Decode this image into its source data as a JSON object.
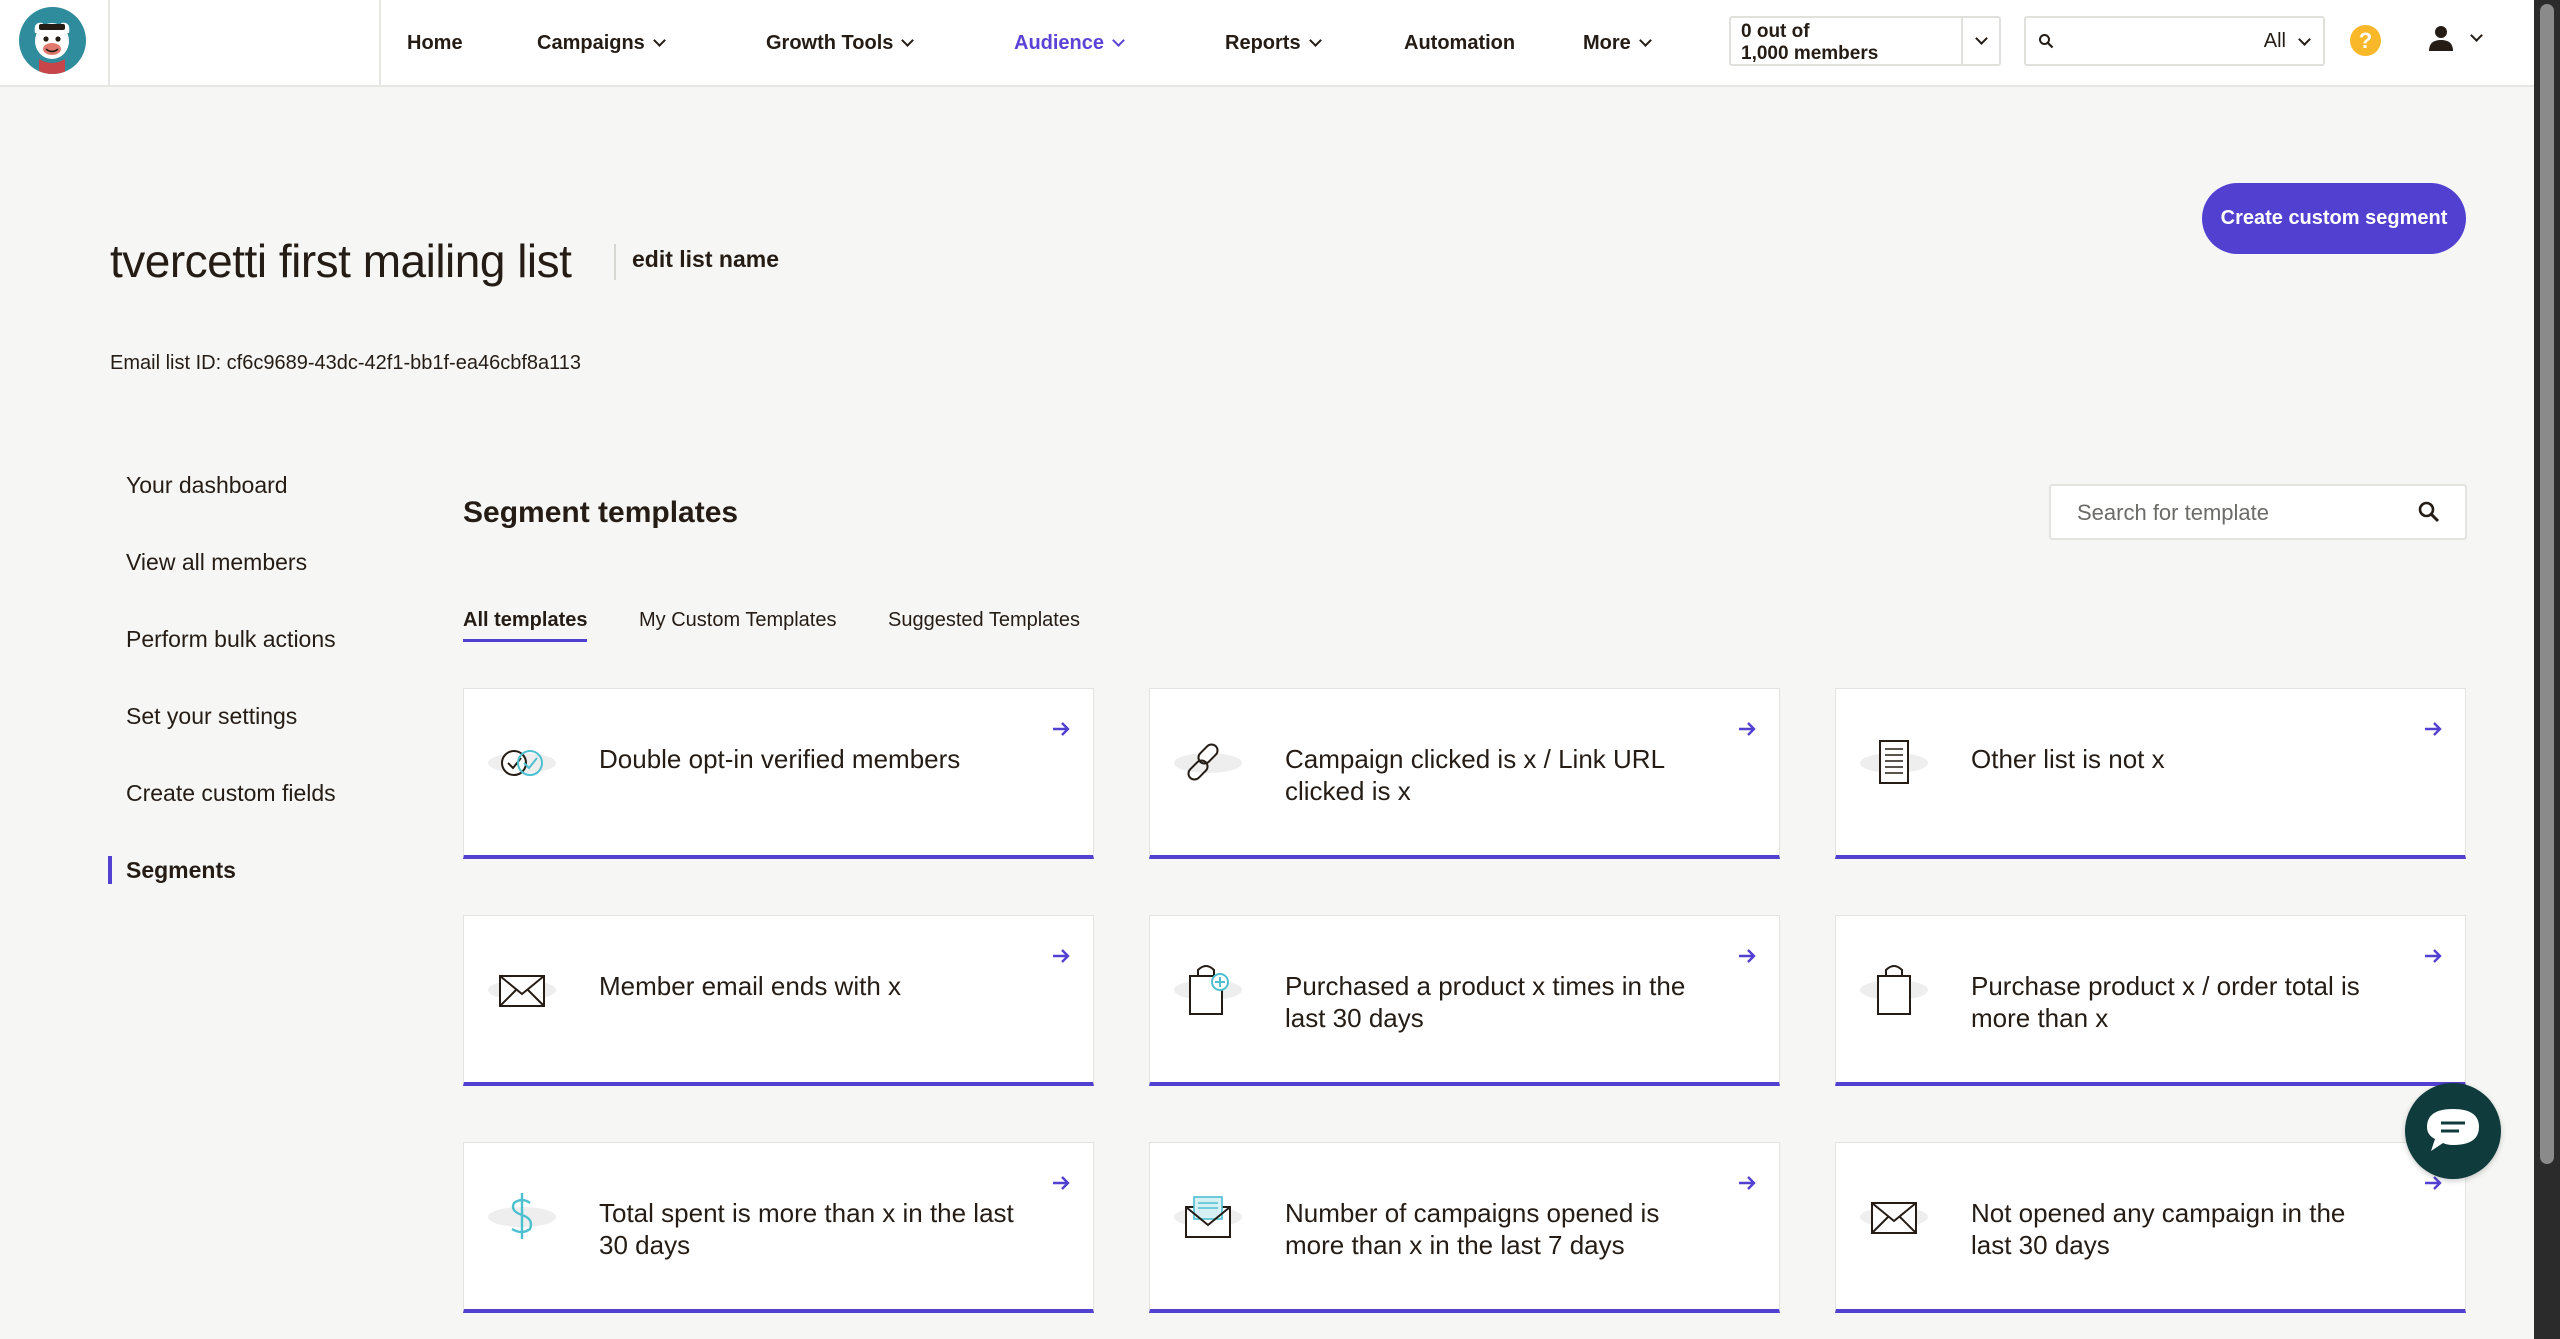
{
  "nav": {
    "items": [
      {
        "label": "Home",
        "has_menu": false
      },
      {
        "label": "Campaigns",
        "has_menu": true
      },
      {
        "label": "Growth Tools",
        "has_menu": true
      },
      {
        "label": "Audience",
        "has_menu": true,
        "active": true
      },
      {
        "label": "Reports",
        "has_menu": true
      },
      {
        "label": "Automation",
        "has_menu": false
      },
      {
        "label": "More",
        "has_menu": true
      }
    ],
    "members_line1": "0 out of",
    "members_line2": "1,000 members",
    "search_scope": "All",
    "help_label": "?",
    "icons": {
      "logo": "mailchimp-freddie-logo-icon",
      "search": "search-icon",
      "help": "help-icon",
      "account": "user-icon"
    }
  },
  "header": {
    "title": "tvercetti first mailing list",
    "edit_label": "edit list name",
    "list_id": "Email list ID: cf6c9689-43dc-42f1-bb1f-ea46cbf8a113",
    "create_button": "Create custom segment"
  },
  "sidebar": {
    "items": [
      {
        "label": "Your dashboard"
      },
      {
        "label": "View all members"
      },
      {
        "label": "Perform bulk actions"
      },
      {
        "label": "Set your settings"
      },
      {
        "label": "Create custom fields"
      },
      {
        "label": "Segments",
        "active": true
      }
    ]
  },
  "templates": {
    "title": "Segment templates",
    "search_placeholder": "Search for template",
    "tabs": [
      {
        "label": "All templates",
        "active": true
      },
      {
        "label": "My Custom Templates"
      },
      {
        "label": "Suggested Templates"
      }
    ],
    "cards": [
      {
        "label": "Double opt-in verified members",
        "icon": "verified-check-icon"
      },
      {
        "label": "Campaign clicked is x / Link URL clicked is x",
        "icon": "link-icon"
      },
      {
        "label": "Other list is not x",
        "icon": "list-document-icon"
      },
      {
        "label": "Member email ends with x",
        "icon": "envelope-icon"
      },
      {
        "label": "Purchased a product x times in the last 30 days",
        "icon": "shopping-bag-plus-icon"
      },
      {
        "label": "Purchase product x / order total is more than x",
        "icon": "shopping-bag-icon"
      },
      {
        "label": "Total spent is more than x in the last 30 days",
        "icon": "dollar-icon"
      },
      {
        "label": "Number of campaigns opened is more than x in the last 7 days",
        "icon": "open-envelope-icon"
      },
      {
        "label": "Not opened any campaign in the last 30 days",
        "icon": "envelope-icon"
      }
    ]
  },
  "colors": {
    "accent": "#5240d1",
    "nav_active": "#5c43d6",
    "help": "#f8b829",
    "chat": "#0f3b3c",
    "logo_bg": "#2f8c9c"
  },
  "chat": {
    "icon": "chat-icon"
  }
}
